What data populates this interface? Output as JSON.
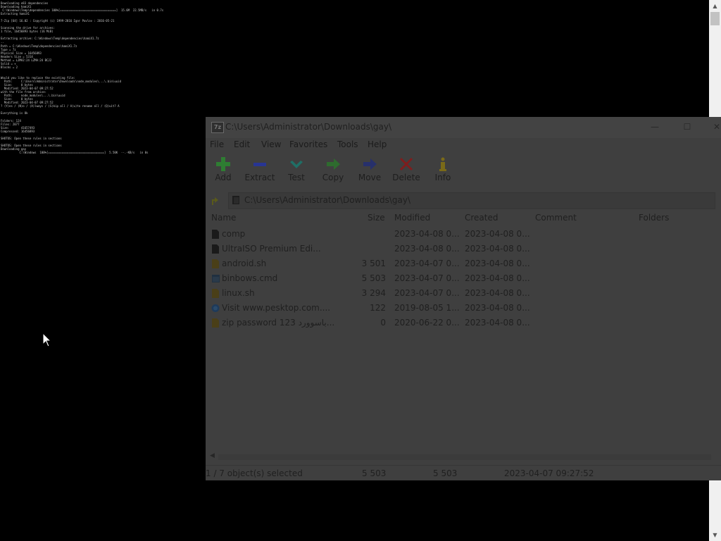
{
  "console": {
    "text": "Downloading e83 dependencies\nDownloading hamiX1\n C:\\Windows\\Temp\\dependencies 100%[=================================]  15.6M  22.5MB/s   in 0.7s\nExtracting hamiX1\n\n7-Zip [64] 16.02 : Copyright (c) 1999-2016 Igor Pavlov : 2016-05-21\n\nScanning the drive for archives:\n1 file, 16456893 bytes (16 MiB)\n\nExtracting archive: C:\\Windows\\Temp\\dependencies\\hamiX1.7z\n--\nPath = C:\\Windows\\Temp\\dependencies\\hamiX1.7z\nType = 7z\nPhysical Size = 16456893\nHeaders Size = 5314\nMethod = LZMA2:24 LZMA:24 BCJ2\nSolid = +\nBlocks = 2\n\n\nWould you like to replace the existing file:\n  Path:     C:\\Users\\Administrator\\Downloads\\node_modules\\...\\.bin\\uuid\n  Size:     0 bytes\n  Modified: 2023-04-07 09:27:52\nwith the file from archive:\n  Path:     node_modules\\...\\.bin\\uuid\n  Size:     0 bytes\n  Modified: 2023-04-07 09:27:52\n? (Y)es / (N)o / (A)lways / (S)kip all / A(u)to rename all / (Q)uit? A\n\nEverything is Ok\n\nFolders: 124\nFiles: 2077\nSize:       41657493\nCompressed: 16456893\n\nSHOTOS: Open these rules in sections\n\nSHOTOS: Open these rules in sections\nDownloading gay\n           C:\\Windows  100%[=================================]  5.50K  --.-KB/s   in 0s"
  },
  "window": {
    "title": "C:\\Users\\Administrator\\Downloads\\gay\\",
    "app_icon_text": "7z",
    "controls": {
      "minimize": "—",
      "maximize": "☐",
      "close": "✕"
    }
  },
  "menu": [
    "File",
    "Edit",
    "View",
    "Favorites",
    "Tools",
    "Help"
  ],
  "toolbar": [
    {
      "label": "Add",
      "icon": "plus-icon",
      "color": "#2e7d32"
    },
    {
      "label": "Extract",
      "icon": "minus-icon",
      "color": "#283593"
    },
    {
      "label": "Test",
      "icon": "check-icon",
      "color": "#1f6f66"
    },
    {
      "label": "Copy",
      "icon": "arrow-right-icon",
      "color": "#2e6b2e"
    },
    {
      "label": "Move",
      "icon": "arrow-right-icon",
      "color": "#27306b"
    },
    {
      "label": "Delete",
      "icon": "x-icon",
      "color": "#7f1d1d"
    },
    {
      "label": "Info",
      "icon": "info-icon",
      "color": "#7a6a18"
    }
  ],
  "address": {
    "path": "C:\\Users\\Administrator\\Downloads\\gay\\"
  },
  "columns": [
    "Name",
    "Size",
    "Modified",
    "Created",
    "Comment",
    "Folders"
  ],
  "files": [
    {
      "name": "comp",
      "size": "",
      "modified": "2023-04-08 0...",
      "created": "2023-04-08 0...",
      "icon": "folder-icon"
    },
    {
      "name": "UltraISO Premium Edi...",
      "size": "",
      "modified": "2023-04-08 0...",
      "created": "2023-04-08 0...",
      "icon": "folder-icon"
    },
    {
      "name": "android.sh",
      "size": "3 501",
      "modified": "2023-04-07 0...",
      "created": "2023-04-08 0...",
      "icon": "script-file-icon"
    },
    {
      "name": "binbows.cmd",
      "size": "5 503",
      "modified": "2023-04-07 0...",
      "created": "2023-04-08 0...",
      "icon": "cmd-file-icon"
    },
    {
      "name": "linux.sh",
      "size": "3 294",
      "modified": "2023-04-07 0...",
      "created": "2023-04-08 0...",
      "icon": "script-file-icon"
    },
    {
      "name": "Visit www.pesktop.com....",
      "size": "122",
      "modified": "2019-08-05 1...",
      "created": "2023-04-08 0...",
      "icon": "url-file-icon"
    },
    {
      "name": "zip password 123 باسوورد...",
      "size": "0",
      "modified": "2020-06-22 0...",
      "created": "2023-04-08 0...",
      "icon": "text-file-icon"
    }
  ],
  "status": {
    "selection": "1 / 7 object(s) selected",
    "size": "5 503",
    "packed": "5 503",
    "date": "2023-04-07 09:27:52"
  },
  "colors": {
    "overlay_window": "#3f3f3f",
    "console_bg": "#000000",
    "console_text": "#c9c9c9"
  }
}
